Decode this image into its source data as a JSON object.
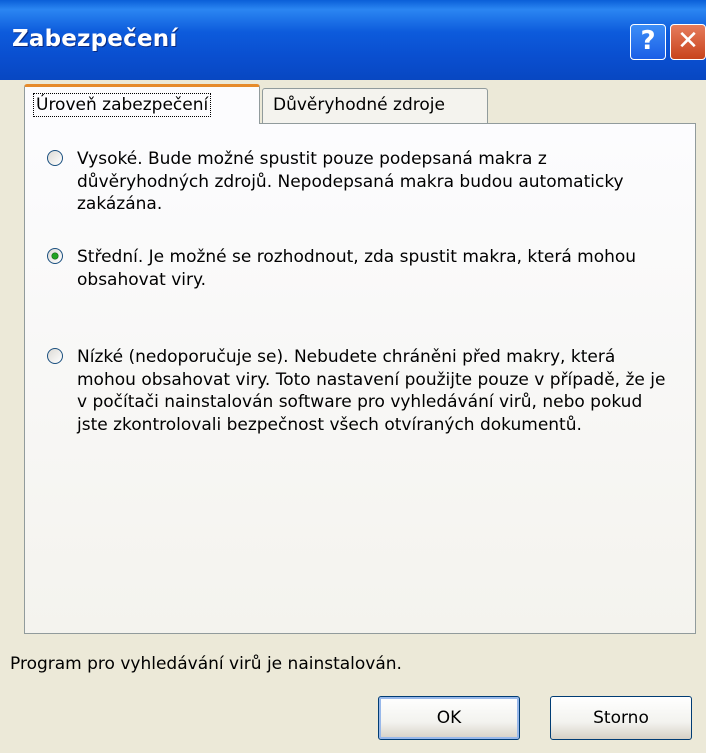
{
  "window": {
    "title": "Zabezpečení",
    "help_glyph": "?",
    "close_glyph": "✕"
  },
  "tabs": [
    {
      "label": "Úroveň zabezpečení",
      "active": true
    },
    {
      "label": "Důvěryhodné zdroje",
      "active": false
    }
  ],
  "options": [
    {
      "text": "Vysoké. Bude možné spustit pouze podepsaná makra z důvěryhodných zdrojů. Nepodepsaná makra budou automaticky zakázána.",
      "checked": false
    },
    {
      "text": "Střední. Je možné se rozhodnout, zda spustit makra, která mohou obsahovat viry.",
      "checked": true
    },
    {
      "text": "Nízké (nedoporučuje se). Nebudete chráněni před makry, která mohou obsahovat viry. Toto nastavení použijte pouze v případě, že je v počítači nainstalován software pro vyhledávání virů, nebo pokud jste zkontrolovali bezpečnost všech otvíraných dokumentů.",
      "checked": false
    }
  ],
  "status_text": "Program pro vyhledávání virů je nainstalován.",
  "buttons": {
    "ok": "OK",
    "cancel": "Storno"
  }
}
